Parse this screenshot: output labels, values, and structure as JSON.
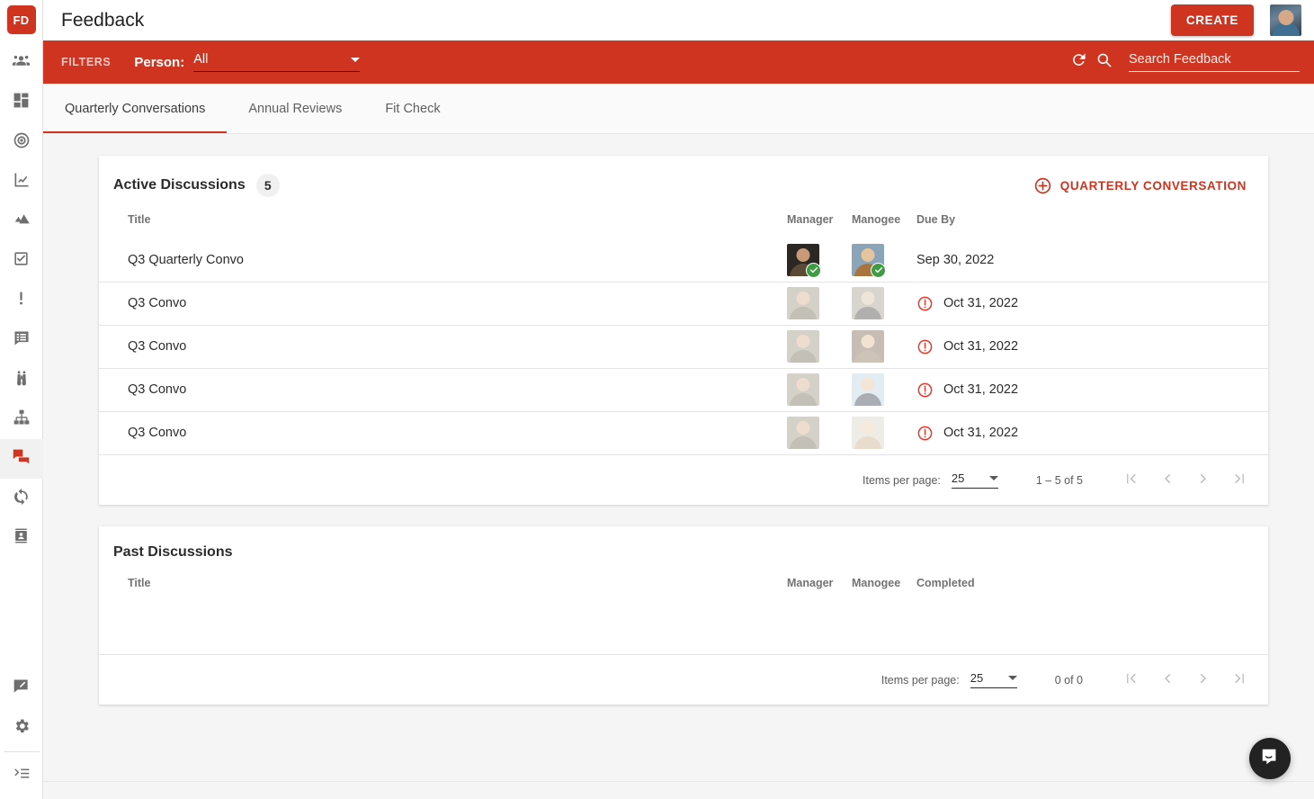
{
  "brand": {
    "red": "#ce3420",
    "green": "#3f9c45",
    "page_bg": "#f5f5f5"
  },
  "sidebar": {
    "logo_text": "FD",
    "items": [
      {
        "name": "people-icon",
        "label": "People"
      },
      {
        "name": "dashboard-grid-icon",
        "label": "Dashboard"
      },
      {
        "name": "target-icon",
        "label": "Goals"
      },
      {
        "name": "line-chart-icon",
        "label": "Analytics"
      },
      {
        "name": "mountains-icon",
        "label": "Growth"
      },
      {
        "name": "checkbox-icon",
        "label": "Tasks"
      },
      {
        "name": "exclamation-icon",
        "label": "Alerts"
      },
      {
        "name": "message-list-icon",
        "label": "Surveys"
      },
      {
        "name": "binoculars-icon",
        "label": "Discovery"
      },
      {
        "name": "org-chart-icon",
        "label": "Org Chart"
      },
      {
        "name": "feedback-chat-icon",
        "label": "Feedback"
      },
      {
        "name": "sync-icon",
        "label": "Sync"
      },
      {
        "name": "contact-card-icon",
        "label": "Directory"
      }
    ],
    "bottom_items": [
      {
        "name": "edit-feedback-icon",
        "label": "Send Feedback"
      },
      {
        "name": "gear-icon",
        "label": "Settings"
      },
      {
        "name": "collapse-menu-icon",
        "label": "Collapse Menu"
      }
    ]
  },
  "header": {
    "title": "Feedback",
    "create_label": "CREATE",
    "avatar_name": "user-avatar"
  },
  "filters": {
    "filters_label": "FILTERS",
    "person_label": "Person:",
    "person_value": "All",
    "person_options": [
      "All"
    ],
    "refresh_icon": "refresh-icon",
    "search_icon": "search-icon",
    "search_value": "",
    "search_placeholder": "Search Feedback"
  },
  "tabs": [
    {
      "label": "Quarterly Conversations",
      "active": true
    },
    {
      "label": "Annual Reviews",
      "active": false
    },
    {
      "label": "Fit Check",
      "active": false
    }
  ],
  "active_discussions": {
    "title": "Active Discussions",
    "count": "5",
    "add_label": "QUARTERLY CONVERSATION",
    "columns": {
      "title": "Title",
      "manager": "Manager",
      "manogee": "Manogee",
      "due_by": "Due By"
    },
    "rows": [
      {
        "title": "Q3 Quarterly Convo",
        "due": "Sep 30, 2022",
        "overdue": false,
        "manager_complete": true,
        "manogee_complete": true,
        "manager_colors": {
          "bg": "#2a2724",
          "head": "#c99a78",
          "body": "#5a4a36"
        },
        "manogee_colors": {
          "bg": "#8aa4b8",
          "head": "#e6c59e",
          "body": "#a9753f"
        }
      },
      {
        "title": "Q3 Convo",
        "due": "Oct 31, 2022",
        "overdue": true,
        "manager_complete": false,
        "manogee_complete": false,
        "manager_colors": {
          "bg": "#9a937f",
          "head": "#d8b08c",
          "body": "#6f6a55"
        },
        "manogee_colors": {
          "bg": "#a39b8d",
          "head": "#d8c3a5",
          "body": "#4a4640"
        }
      },
      {
        "title": "Q3 Convo",
        "due": "Oct 31, 2022",
        "overdue": true,
        "manager_complete": false,
        "manogee_complete": false,
        "manager_colors": {
          "bg": "#9a937f",
          "head": "#d8b08c",
          "body": "#6f6a55"
        },
        "manogee_colors": {
          "bg": "#7c6450",
          "head": "#e0bb92",
          "body": "#8a7355"
        }
      },
      {
        "title": "Q3 Convo",
        "due": "Oct 31, 2022",
        "overdue": true,
        "manager_complete": false,
        "manogee_complete": false,
        "manager_colors": {
          "bg": "#9a937f",
          "head": "#d8b08c",
          "body": "#6f6a55"
        },
        "manogee_colors": {
          "bg": "#bcd3e4",
          "head": "#e7c3a0",
          "body": "#36414f"
        }
      },
      {
        "title": "Q3 Convo",
        "due": "Oct 31, 2022",
        "overdue": true,
        "manager_complete": false,
        "manogee_complete": false,
        "manager_colors": {
          "bg": "#9a937f",
          "head": "#d8b08c",
          "body": "#6f6a55"
        },
        "manogee_colors": {
          "bg": "#d8d2c6",
          "head": "#eccfae",
          "body": "#c9b08a"
        }
      }
    ],
    "paginator": {
      "items_per_page_label": "Items per page:",
      "items_per_page_value": "25",
      "range_label": "1 – 5 of 5",
      "first_icon": "first-page-icon",
      "prev_icon": "previous-page-icon",
      "next_icon": "next-page-icon",
      "last_icon": "last-page-icon"
    }
  },
  "past_discussions": {
    "title": "Past Discussions",
    "columns": {
      "title": "Title",
      "manager": "Manager",
      "manogee": "Manogee",
      "completed": "Completed"
    },
    "rows": [],
    "paginator": {
      "items_per_page_label": "Items per page:",
      "items_per_page_value": "25",
      "range_label": "0 of 0",
      "first_icon": "first-page-icon",
      "prev_icon": "previous-page-icon",
      "next_icon": "next-page-icon",
      "last_icon": "last-page-icon"
    }
  },
  "intercom": {
    "icon": "intercom-chat-icon"
  }
}
